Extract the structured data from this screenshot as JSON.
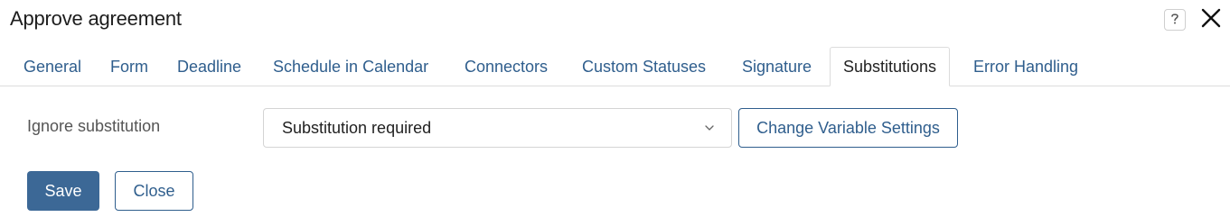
{
  "window": {
    "title": "Approve agreement",
    "help_icon": "question-icon",
    "close_icon": "close-icon"
  },
  "tabs": [
    {
      "label": "General"
    },
    {
      "label": "Form"
    },
    {
      "label": "Deadline"
    },
    {
      "label": "Schedule in Calendar"
    },
    {
      "label": "Connectors"
    },
    {
      "label": "Custom Statuses"
    },
    {
      "label": "Signature"
    },
    {
      "label": "Substitutions",
      "active": true
    },
    {
      "label": "Error Handling"
    }
  ],
  "form": {
    "ignore_label": "Ignore substitution",
    "select_value": "Substitution required",
    "change_button": "Change Variable Settings"
  },
  "actions": {
    "save": "Save",
    "close": "Close"
  },
  "colors": {
    "accent": "#2f5e8d",
    "primary_button": "#3c6896"
  }
}
